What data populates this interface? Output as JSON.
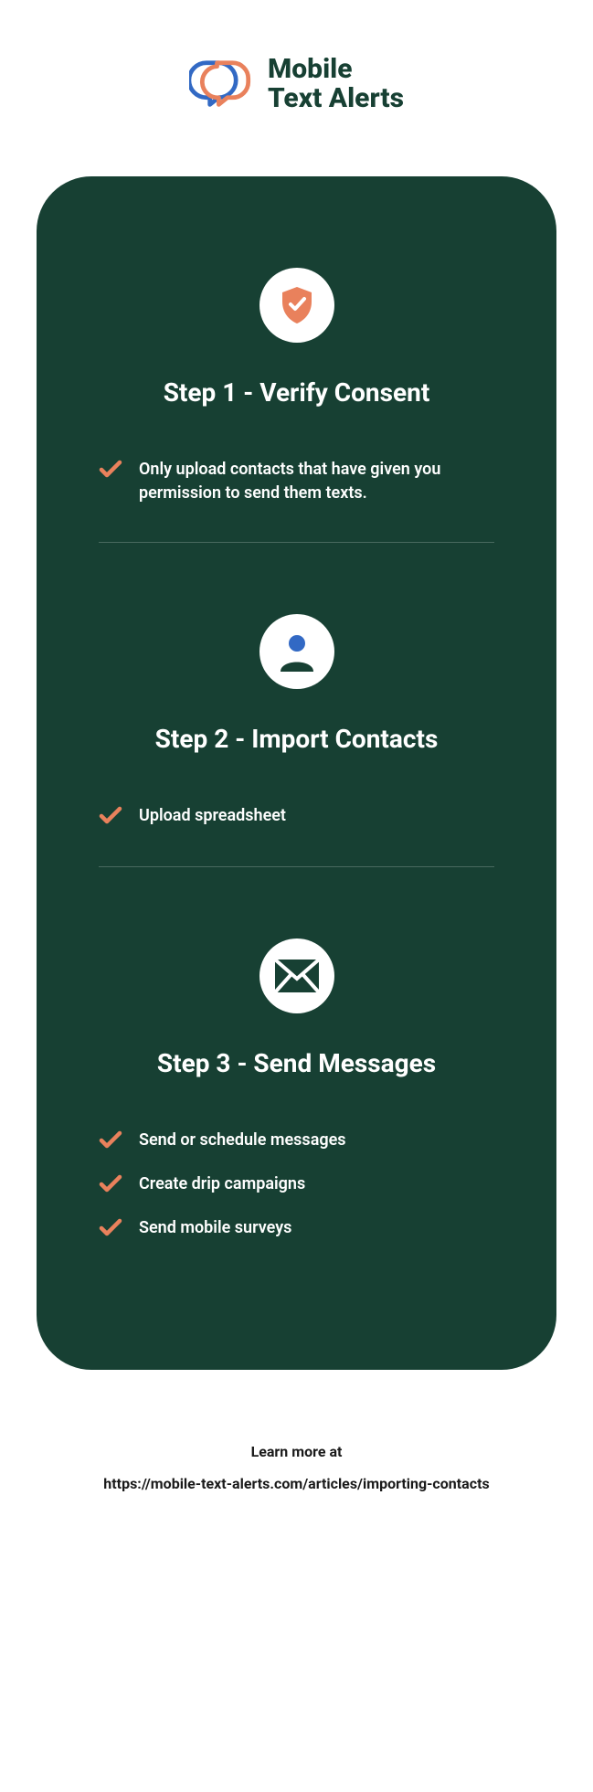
{
  "brand": {
    "line1": "Mobile",
    "line2": "Text Alerts"
  },
  "steps": [
    {
      "title": "Step 1 - Verify Consent",
      "icon": "shield-check",
      "items": [
        "Only upload contacts that have given you permission to send them texts."
      ]
    },
    {
      "title": "Step 2 - Import Contacts",
      "icon": "person",
      "items": [
        "Upload spreadsheet"
      ]
    },
    {
      "title": "Step 3 - Send Messages",
      "icon": "envelope",
      "items": [
        "Send or schedule messages",
        "Create drip campaigns",
        "Send mobile surveys"
      ]
    }
  ],
  "footer": {
    "line1": "Learn more at",
    "line2": "https://mobile-text-alerts.com/articles/importing-contacts"
  },
  "colors": {
    "card_bg": "#174033",
    "accent": "#e9815c",
    "accent_blue": "#3269c4"
  }
}
